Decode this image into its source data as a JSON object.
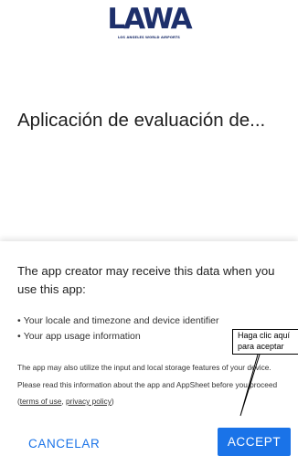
{
  "logo": {
    "mark": "LAWA",
    "subtitle": "LOS ANGELES WORLD AIRPORTS"
  },
  "app": {
    "title": "Aplicación de evaluación de..."
  },
  "dialog": {
    "heading": "The app creator may receive this data when you use this app:",
    "bullets": [
      "Your locale and timezone and device identifier",
      "Your app usage information"
    ],
    "disclaimer_before": "The app may also utilize the input and local storage features of your device. Please read this information about the app and AppSheet before you proceed (",
    "terms_link": "terms of use",
    "separator": ", ",
    "privacy_link": "privacy policy",
    "disclaimer_after": ")"
  },
  "actions": {
    "cancel_label": "CANCELAR",
    "accept_label": "ACCEPT"
  },
  "tooltip": {
    "line1": "Haga clic aquí",
    "line2": "para aceptar"
  },
  "colors": {
    "accent": "#1a73e8",
    "logo": "#1d2f6b"
  }
}
